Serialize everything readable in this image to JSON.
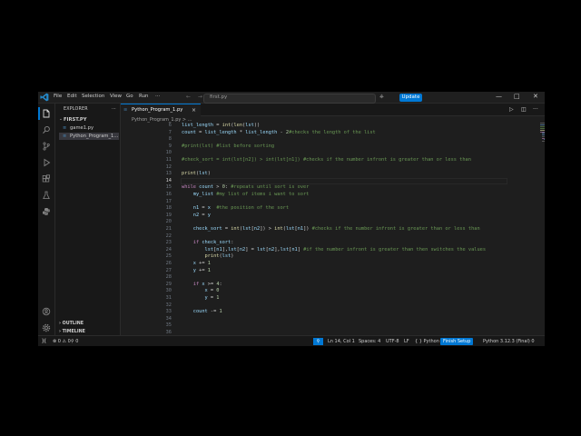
{
  "titlebar": {
    "menus": [
      "File",
      "Edit",
      "Selection",
      "View",
      "Go",
      "Run",
      "···"
    ],
    "nav_arrows": "← →",
    "command_center": "first.py",
    "update_label": "Update",
    "window_controls": [
      "—",
      "□",
      "✕"
    ]
  },
  "activity_bar": {
    "icons": [
      "files-icon",
      "search-icon",
      "source-control-icon",
      "run-debug-icon",
      "extensions-icon",
      "testing-icon",
      "python-icon"
    ],
    "bottom_icons": [
      "account-icon",
      "manage-gear-icon"
    ]
  },
  "sidebar": {
    "header": "EXPLORER",
    "folder": "FIRST.PY",
    "files": [
      "game1.py",
      "Python_Program_1..."
    ],
    "selected_index": 1,
    "sections": [
      "OUTLINE",
      "TIMELINE"
    ]
  },
  "editor": {
    "tab_label": "Python_Program_1.py",
    "breadcrumb": "Python_Program_1.py > ...",
    "current_line": 14,
    "lines": [
      {
        "n": "6",
        "text": "list_length = int(len(lst))"
      },
      {
        "n": "7",
        "text": "count = list_length * list_length - 2#checks the length of the list"
      },
      {
        "n": "8",
        "text": ""
      },
      {
        "n": "9",
        "text": "#print(lst) #list before sorting"
      },
      {
        "n": "10",
        "text": ""
      },
      {
        "n": "11",
        "text": "#check_sort = int(lst[n2]) > int(lst[n1]) #checks if the number infront is greater than or less than"
      },
      {
        "n": "12",
        "text": ""
      },
      {
        "n": "13",
        "text": "print(lst)"
      },
      {
        "n": "14",
        "text": ""
      },
      {
        "n": "15",
        "text": "while count > 0: #repeats until sort is over"
      },
      {
        "n": "16",
        "text": "    my_list #my list of items i want to sort"
      },
      {
        "n": "17",
        "text": ""
      },
      {
        "n": "18",
        "text": "    n1 = x  #the position of the sort"
      },
      {
        "n": "19",
        "text": "    n2 = y"
      },
      {
        "n": "20",
        "text": ""
      },
      {
        "n": "21",
        "text": "    check_sort = int(lst[n2]) > int(lst[n1]) #checks if the number infront is greater than or less than"
      },
      {
        "n": "22",
        "text": ""
      },
      {
        "n": "23",
        "text": "    if check_sort:"
      },
      {
        "n": "24",
        "text": "        lst[n1],lst[n2] = lst[n2],lst[n1] #if the number infront is greater than then switches the values"
      },
      {
        "n": "25",
        "text": "        print(lst)"
      },
      {
        "n": "26",
        "text": "    x += 1"
      },
      {
        "n": "27",
        "text": "    y += 1"
      },
      {
        "n": "28",
        "text": ""
      },
      {
        "n": "29",
        "text": "    if x >= 4:"
      },
      {
        "n": "30",
        "text": "        x = 0"
      },
      {
        "n": "31",
        "text": "        y = 1"
      },
      {
        "n": "32",
        "text": ""
      },
      {
        "n": "33",
        "text": "    count -= 1"
      },
      {
        "n": "34",
        "text": ""
      },
      {
        "n": "35",
        "text": ""
      },
      {
        "n": "36",
        "text": ""
      }
    ]
  },
  "statusbar": {
    "problems": "⊗ 0 ⚠ 0",
    "ports": "⚲ 0",
    "position": "Ln 14, Col 1",
    "spaces": "Spaces: 4",
    "encoding": "UTF-8",
    "eol": "LF",
    "language": "{ } Python",
    "finish_setup": "Finish Setup",
    "interpreter": "Python 3.12.3 (Final) 0"
  },
  "colors": {
    "accent": "#0078d4",
    "keyword": "#c586c0",
    "function": "#dcdcaa",
    "variable": "#9cdcfe",
    "number": "#b5cea8",
    "comment": "#6a9955",
    "builtin_type": "#4ec9b0"
  }
}
